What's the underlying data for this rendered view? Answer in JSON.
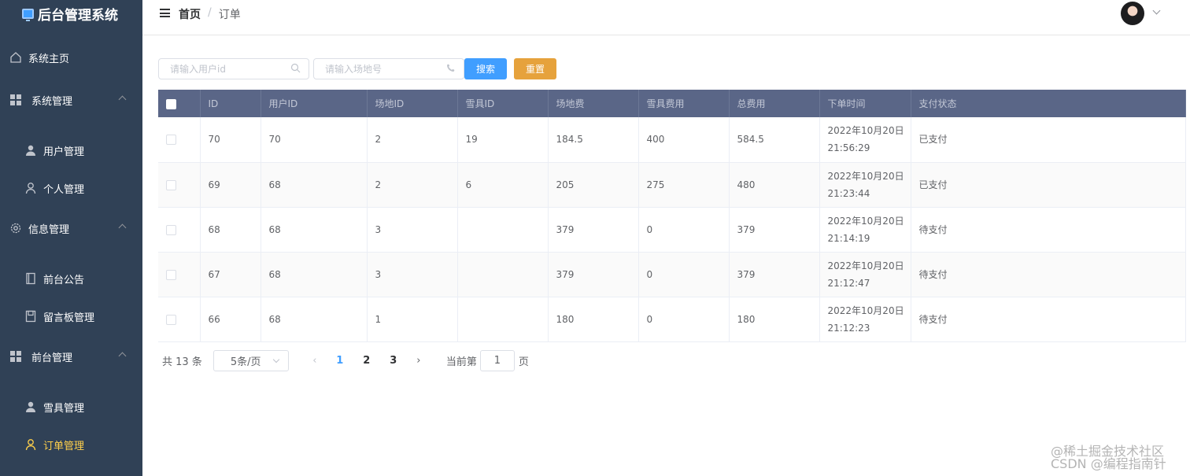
{
  "sidebar": {
    "title": "后台管理系统",
    "items": [
      {
        "label": "系统主页",
        "icon": "home-icon"
      },
      {
        "label": "系统管理",
        "icon": "grid-icon"
      },
      {
        "label": "用户管理",
        "icon": "user-icon"
      },
      {
        "label": "个人管理",
        "icon": "user-outline-icon"
      },
      {
        "label": "信息管理",
        "icon": "gear-icon"
      },
      {
        "label": "前台公告",
        "icon": "notebook-icon"
      },
      {
        "label": "留言板管理",
        "icon": "board-icon"
      },
      {
        "label": "前台管理",
        "icon": "grid-icon"
      },
      {
        "label": "雪具管理",
        "icon": "user-icon"
      },
      {
        "label": "订单管理",
        "icon": "user-outline-icon"
      }
    ],
    "active_color": "#ffd04b"
  },
  "header": {
    "breadcrumb_home": "首页",
    "breadcrumb_sep": "/",
    "breadcrumb_current": "订单"
  },
  "search": {
    "user_placeholder": "请输入用户id",
    "venue_placeholder": "请输入场地号",
    "search_label": "搜索",
    "reset_label": "重置"
  },
  "table": {
    "columns": [
      "ID",
      "用户ID",
      "场地ID",
      "雪具ID",
      "场地费",
      "雪具费用",
      "总费用",
      "下单时间",
      "支付状态"
    ],
    "rows": [
      {
        "id": "70",
        "user_id": "70",
        "venue_id": "2",
        "gear_id": "19",
        "venue_fee": "184.5",
        "gear_fee": "400",
        "total": "584.5",
        "date": "2022年10月20日",
        "time": "21:56:29",
        "status": "已支付"
      },
      {
        "id": "69",
        "user_id": "68",
        "venue_id": "2",
        "gear_id": "6",
        "venue_fee": "205",
        "gear_fee": "275",
        "total": "480",
        "date": "2022年10月20日",
        "time": "21:23:44",
        "status": "已支付"
      },
      {
        "id": "68",
        "user_id": "68",
        "venue_id": "3",
        "gear_id": "",
        "venue_fee": "379",
        "gear_fee": "0",
        "total": "379",
        "date": "2022年10月20日",
        "time": "21:14:19",
        "status": "待支付"
      },
      {
        "id": "67",
        "user_id": "68",
        "venue_id": "3",
        "gear_id": "",
        "venue_fee": "379",
        "gear_fee": "0",
        "total": "379",
        "date": "2022年10月20日",
        "time": "21:12:47",
        "status": "待支付"
      },
      {
        "id": "66",
        "user_id": "68",
        "venue_id": "1",
        "gear_id": "",
        "venue_fee": "180",
        "gear_fee": "0",
        "total": "180",
        "date": "2022年10月20日",
        "time": "21:12:23",
        "status": "待支付"
      }
    ]
  },
  "pagination": {
    "total": "共 13 条",
    "page_size": "5条/页",
    "pages": [
      "1",
      "2",
      "3"
    ],
    "current_page": "1",
    "goto_prefix": "当前第",
    "goto_value": "1",
    "goto_suffix": "页"
  },
  "watermark": {
    "line1": "@稀土掘金技术社区",
    "line2": "CSDN @编程指南针"
  }
}
